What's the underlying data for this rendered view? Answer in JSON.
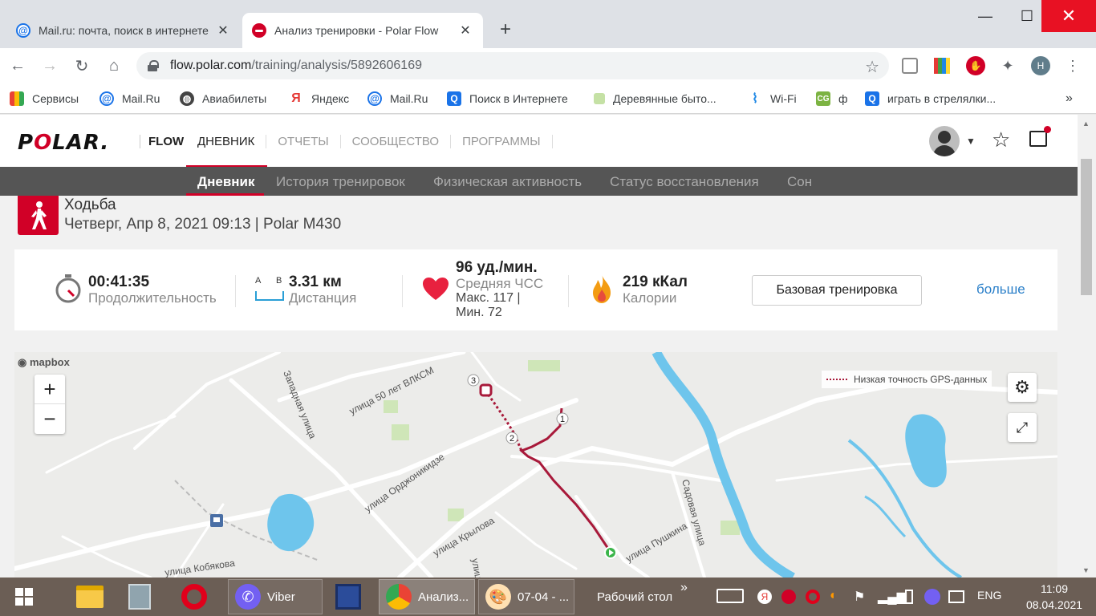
{
  "browser": {
    "tabs": [
      {
        "label": "Mail.ru: почта, поиск в интернете",
        "active": false
      },
      {
        "label": "Анализ тренировки - Polar Flow",
        "active": true
      }
    ],
    "url_host": "flow.polar.com",
    "url_path": "/training/analysis/5892606169",
    "profile_initial": "Н",
    "bookmarks": [
      "Сервисы",
      "Mail.Ru",
      "Авиабилеты",
      "Яндекс",
      "Mail.Ru",
      "Поиск в Интернете",
      "Деревянные быто...",
      "Wi-Fi",
      "ф",
      "играть в стрелялки..."
    ],
    "bookmarks_more": "»"
  },
  "polar": {
    "logo": "POLAR.",
    "app": "FLOW",
    "topnav": [
      "ДНЕВНИК",
      "ОТЧЕТЫ",
      "СООБЩЕСТВО",
      "ПРОГРАММЫ"
    ],
    "subnav": [
      "Дневник",
      "История тренировок",
      "Физическая активность",
      "Статус восстановления",
      "Сон"
    ]
  },
  "activity": {
    "title": "Ходьба",
    "meta": "Четверг, Апр 8, 2021 09:13 | Polar M430"
  },
  "summary": {
    "duration_value": "00:41:35",
    "duration_label": "Продолжительность",
    "distance_a": "A",
    "distance_b": "B",
    "distance_value": "3.31 км",
    "distance_label": "Дистанция",
    "hr_value": "96 уд./мин.",
    "hr_label": "Средняя ЧСС",
    "hr_max": "Макс. 117  |",
    "hr_min": "Мин. 72",
    "calories_value": "219 кКал",
    "calories_label": "Калории",
    "training_button": "Базовая тренировка",
    "more_link": "больше"
  },
  "map": {
    "attribution": "mapbox",
    "zoom_in": "+",
    "zoom_out": "−",
    "gps_legend": "Низкая точность GPS-данных",
    "streets": [
      "улица 50 лет ВЛКСМ",
      "Западная улица",
      "улица Орджоникидзе",
      "улица Крылова",
      "Садовая улица",
      "улица Пушкина",
      "улица Кобякова",
      "улица"
    ],
    "markers": [
      "1",
      "2",
      "3"
    ],
    "route_color": "#a8193a"
  },
  "taskbar": {
    "apps": [
      "Viber",
      "Анализ...",
      "07-04 - ...",
      "Рабочий стол"
    ],
    "more": "»",
    "language": "ENG",
    "time": "11:09",
    "date": "08.04.2021"
  },
  "colors": {
    "polar_red": "#d10027",
    "link_blue": "#2a7fc9",
    "subnav_bg": "#555555",
    "taskbar_bg": "#6b5e55"
  }
}
